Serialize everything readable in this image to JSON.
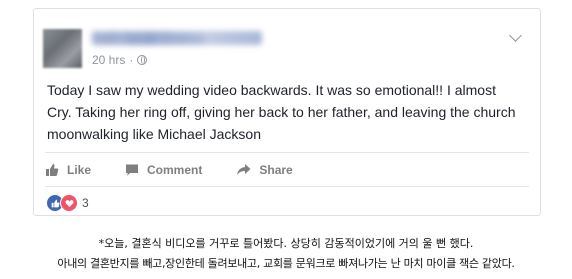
{
  "post": {
    "author_name": "Seth Jacob Greene",
    "timestamp": "20 hrs",
    "timestamp_separator": "·",
    "text": "Today I saw my wedding video backwards. It was so emotional!! I almost Cry. Taking her ring off, giving her back to her father, and leaving the church moonwalking like Michael Jackson"
  },
  "actions": {
    "like": "Like",
    "comment": "Comment",
    "share": "Share"
  },
  "reactions": {
    "icons": [
      "like-icon",
      "love-icon"
    ],
    "count": "3"
  },
  "caption": {
    "line1": "*오늘, 결혼식 비디오를 거꾸로 틀어봤다. 상당히 감동적이었기에 거의 울 뻔 했다.",
    "line2": "아내의 결혼반지를 빼고,장인한테 돌려보내고, 교회를 문워크로 빠져나가는 난 마치 마이클 잭슨 같았다."
  },
  "colors": {
    "link_blue": "#365899",
    "like_blue": "#4267b2",
    "love_red": "#f25268",
    "meta_gray": "#90949c",
    "text": "#1d2129"
  }
}
